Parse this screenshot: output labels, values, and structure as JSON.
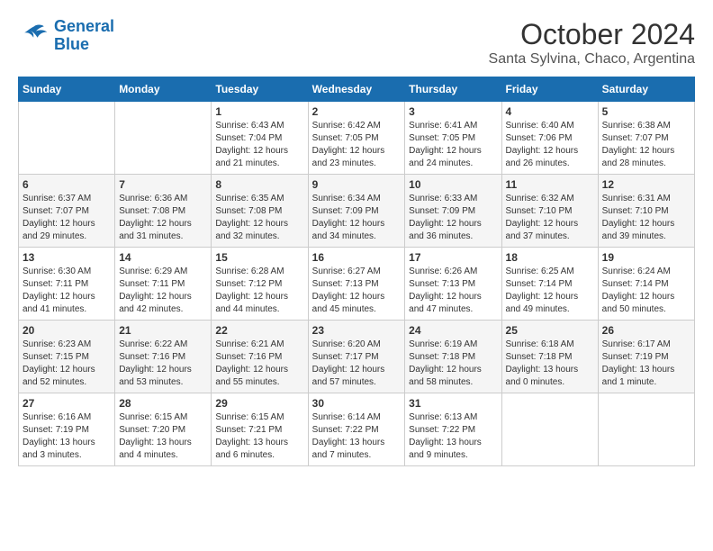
{
  "logo": {
    "line1": "General",
    "line2": "Blue"
  },
  "title": "October 2024",
  "subtitle": "Santa Sylvina, Chaco, Argentina",
  "weekdays": [
    "Sunday",
    "Monday",
    "Tuesday",
    "Wednesday",
    "Thursday",
    "Friday",
    "Saturday"
  ],
  "weeks": [
    [
      {
        "day": "",
        "info": ""
      },
      {
        "day": "",
        "info": ""
      },
      {
        "day": "1",
        "info": "Sunrise: 6:43 AM\nSunset: 7:04 PM\nDaylight: 12 hours and 21 minutes."
      },
      {
        "day": "2",
        "info": "Sunrise: 6:42 AM\nSunset: 7:05 PM\nDaylight: 12 hours and 23 minutes."
      },
      {
        "day": "3",
        "info": "Sunrise: 6:41 AM\nSunset: 7:05 PM\nDaylight: 12 hours and 24 minutes."
      },
      {
        "day": "4",
        "info": "Sunrise: 6:40 AM\nSunset: 7:06 PM\nDaylight: 12 hours and 26 minutes."
      },
      {
        "day": "5",
        "info": "Sunrise: 6:38 AM\nSunset: 7:07 PM\nDaylight: 12 hours and 28 minutes."
      }
    ],
    [
      {
        "day": "6",
        "info": "Sunrise: 6:37 AM\nSunset: 7:07 PM\nDaylight: 12 hours and 29 minutes."
      },
      {
        "day": "7",
        "info": "Sunrise: 6:36 AM\nSunset: 7:08 PM\nDaylight: 12 hours and 31 minutes."
      },
      {
        "day": "8",
        "info": "Sunrise: 6:35 AM\nSunset: 7:08 PM\nDaylight: 12 hours and 32 minutes."
      },
      {
        "day": "9",
        "info": "Sunrise: 6:34 AM\nSunset: 7:09 PM\nDaylight: 12 hours and 34 minutes."
      },
      {
        "day": "10",
        "info": "Sunrise: 6:33 AM\nSunset: 7:09 PM\nDaylight: 12 hours and 36 minutes."
      },
      {
        "day": "11",
        "info": "Sunrise: 6:32 AM\nSunset: 7:10 PM\nDaylight: 12 hours and 37 minutes."
      },
      {
        "day": "12",
        "info": "Sunrise: 6:31 AM\nSunset: 7:10 PM\nDaylight: 12 hours and 39 minutes."
      }
    ],
    [
      {
        "day": "13",
        "info": "Sunrise: 6:30 AM\nSunset: 7:11 PM\nDaylight: 12 hours and 41 minutes."
      },
      {
        "day": "14",
        "info": "Sunrise: 6:29 AM\nSunset: 7:11 PM\nDaylight: 12 hours and 42 minutes."
      },
      {
        "day": "15",
        "info": "Sunrise: 6:28 AM\nSunset: 7:12 PM\nDaylight: 12 hours and 44 minutes."
      },
      {
        "day": "16",
        "info": "Sunrise: 6:27 AM\nSunset: 7:13 PM\nDaylight: 12 hours and 45 minutes."
      },
      {
        "day": "17",
        "info": "Sunrise: 6:26 AM\nSunset: 7:13 PM\nDaylight: 12 hours and 47 minutes."
      },
      {
        "day": "18",
        "info": "Sunrise: 6:25 AM\nSunset: 7:14 PM\nDaylight: 12 hours and 49 minutes."
      },
      {
        "day": "19",
        "info": "Sunrise: 6:24 AM\nSunset: 7:14 PM\nDaylight: 12 hours and 50 minutes."
      }
    ],
    [
      {
        "day": "20",
        "info": "Sunrise: 6:23 AM\nSunset: 7:15 PM\nDaylight: 12 hours and 52 minutes."
      },
      {
        "day": "21",
        "info": "Sunrise: 6:22 AM\nSunset: 7:16 PM\nDaylight: 12 hours and 53 minutes."
      },
      {
        "day": "22",
        "info": "Sunrise: 6:21 AM\nSunset: 7:16 PM\nDaylight: 12 hours and 55 minutes."
      },
      {
        "day": "23",
        "info": "Sunrise: 6:20 AM\nSunset: 7:17 PM\nDaylight: 12 hours and 57 minutes."
      },
      {
        "day": "24",
        "info": "Sunrise: 6:19 AM\nSunset: 7:18 PM\nDaylight: 12 hours and 58 minutes."
      },
      {
        "day": "25",
        "info": "Sunrise: 6:18 AM\nSunset: 7:18 PM\nDaylight: 13 hours and 0 minutes."
      },
      {
        "day": "26",
        "info": "Sunrise: 6:17 AM\nSunset: 7:19 PM\nDaylight: 13 hours and 1 minute."
      }
    ],
    [
      {
        "day": "27",
        "info": "Sunrise: 6:16 AM\nSunset: 7:19 PM\nDaylight: 13 hours and 3 minutes."
      },
      {
        "day": "28",
        "info": "Sunrise: 6:15 AM\nSunset: 7:20 PM\nDaylight: 13 hours and 4 minutes."
      },
      {
        "day": "29",
        "info": "Sunrise: 6:15 AM\nSunset: 7:21 PM\nDaylight: 13 hours and 6 minutes."
      },
      {
        "day": "30",
        "info": "Sunrise: 6:14 AM\nSunset: 7:22 PM\nDaylight: 13 hours and 7 minutes."
      },
      {
        "day": "31",
        "info": "Sunrise: 6:13 AM\nSunset: 7:22 PM\nDaylight: 13 hours and 9 minutes."
      },
      {
        "day": "",
        "info": ""
      },
      {
        "day": "",
        "info": ""
      }
    ]
  ]
}
